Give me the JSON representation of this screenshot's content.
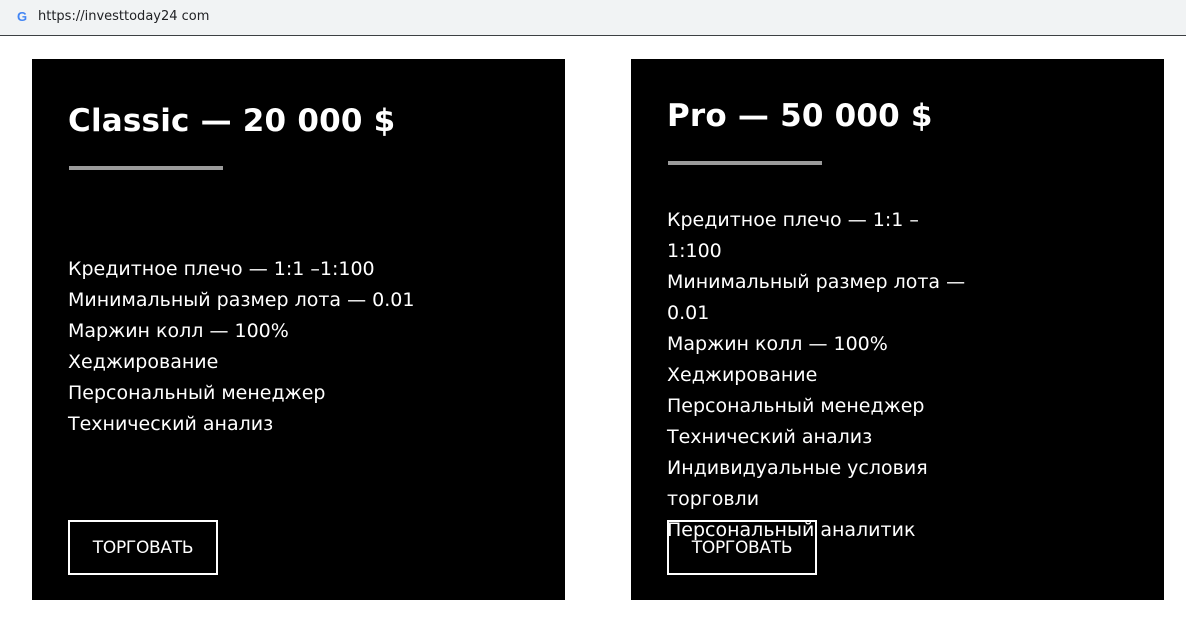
{
  "browser": {
    "url": "https://investtoday24 com",
    "favicon": "google-g-icon"
  },
  "plans": [
    {
      "title": "Classic — 20 000 $",
      "features": [
        "Кредитное плечо — 1:1 –1:100",
        "Минимальный размер лота — 0.01",
        "Маржин колл — 100%",
        "Хеджирование",
        "Персональный менеджер",
        "Технический анализ"
      ],
      "button_label": "ТОРГОВАТЬ"
    },
    {
      "title": "Pro — 50 000 $",
      "features": [
        "Кредитное плечо — 1:1 –1:100",
        "Минимальный размер лота — 0.01",
        "Маржин колл — 100%",
        "Хеджирование",
        "Персональный менеджер",
        "Технический анализ",
        "Индивидуальные условия торговли",
        "Персональный аналитик"
      ],
      "button_label": "ТОРГОВАТЬ"
    }
  ],
  "colors": {
    "card_background": "#000000",
    "card_text": "#ffffff",
    "underline": "#9b9b9b",
    "page_background": "#ffffff"
  }
}
